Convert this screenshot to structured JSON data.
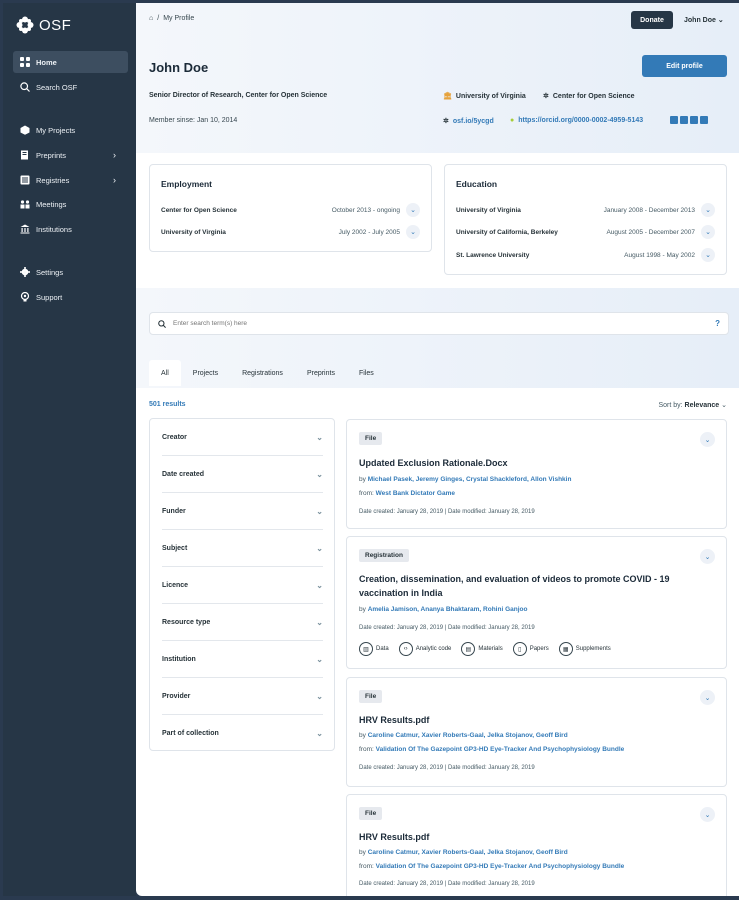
{
  "app": {
    "logo_text": "OSF"
  },
  "sidebar": {
    "items": [
      {
        "label": "Home",
        "icon": "home-grid-icon",
        "active": true
      },
      {
        "label": "Search OSF",
        "icon": "search-icon"
      },
      {
        "label": "My Projects",
        "icon": "cube-icon"
      },
      {
        "label": "Preprints",
        "icon": "preprints-icon",
        "has_submenu": true
      },
      {
        "label": "Registries",
        "icon": "registries-icon",
        "has_submenu": true
      },
      {
        "label": "Meetings",
        "icon": "meetings-icon"
      },
      {
        "label": "Institutions",
        "icon": "institution-icon"
      },
      {
        "label": "Settings",
        "icon": "gear-icon"
      },
      {
        "label": "Support",
        "icon": "support-icon"
      }
    ]
  },
  "header": {
    "breadcrumb": "My Profile",
    "donate_label": "Donate",
    "user_menu_label": "John Doe"
  },
  "profile": {
    "name": "John Doe",
    "edit_label": "Edit profile",
    "title": "Senior Director of Research, Center for Open Science",
    "member_since": "Member sinse: Jan 10, 2014",
    "affiliations": [
      "University of Virginia",
      "Center for Open Science"
    ],
    "osf_link": "osf.io/5ycgd",
    "orcid_link": "https://orcid.org/0000-0002-4959-5143"
  },
  "employment": {
    "heading": "Employment",
    "rows": [
      {
        "org": "Center for Open Science",
        "dates": "October 2013 - ongoing"
      },
      {
        "org": "University of Virginia",
        "dates": "July 2002 - July 2005"
      }
    ]
  },
  "education": {
    "heading": "Education",
    "rows": [
      {
        "org": "University of Virginia",
        "dates": "January 2008 - December 2013"
      },
      {
        "org": "University of California, Berkeley",
        "dates": "August 2005 - December 2007"
      },
      {
        "org": "St. Lawrence University",
        "dates": "August 1998 - May 2002"
      }
    ]
  },
  "search": {
    "placeholder": "Enter search term(s) here",
    "help_label": "?",
    "tabs": [
      "All",
      "Projects",
      "Registrations",
      "Preprints",
      "Files"
    ],
    "results_count": "501 results",
    "sort_label": "Sort by:",
    "sort_value": "Relevance"
  },
  "filters": [
    "Creator",
    "Date created",
    "Funder",
    "Subject",
    "Licence",
    "Resource type",
    "Institution",
    "Provider",
    "Part of collection"
  ],
  "results": [
    {
      "type": "File",
      "title": "Updated Exclusion Rationale.Docx",
      "by_prefix": "by",
      "authors": "Michael Pasek, Jeremy Ginges, Crystal Shackleford, Allon Vishkin",
      "from_prefix": "from:",
      "from": "West Bank Dictator Game",
      "dates": "Date created: January 28, 2019 | Date modified:  January 28, 2019"
    },
    {
      "type": "Registration",
      "title": "Creation, dissemination, and evaluation of videos to promote COVID - 19 vaccination in India",
      "by_prefix": "by",
      "authors": "Amelia Jamison, Ananya Bhaktaram, Rohini Ganjoo",
      "dates": "Date created: January 28, 2019 | Date modified:  January 28, 2019",
      "resources": [
        "Data",
        "Analytic code",
        "Materials",
        "Papers",
        "Supplements"
      ]
    },
    {
      "type": "File",
      "title": "HRV Results.pdf",
      "by_prefix": "by",
      "authors": "Caroline Catmur, Xavier Roberts-Gaal, Jelka Stojanov, Geoff Bird",
      "from_prefix": "from:",
      "from": "Validation Of The Gazepoint GP3-HD Eye-Tracker And Psychophysiology Bundle",
      "dates": "Date created: January 28, 2019 | Date modified:  January 28, 2019"
    },
    {
      "type": "File",
      "title": "HRV Results.pdf",
      "by_prefix": "by",
      "authors": "Caroline Catmur, Xavier Roberts-Gaal, Jelka Stojanov, Geoff Bird",
      "from_prefix": "from:",
      "from": "Validation Of The Gazepoint GP3-HD Eye-Tracker And Psychophysiology Bundle",
      "dates": "Date created: January 28, 2019 | Date modified:  January 28, 2019"
    }
  ]
}
